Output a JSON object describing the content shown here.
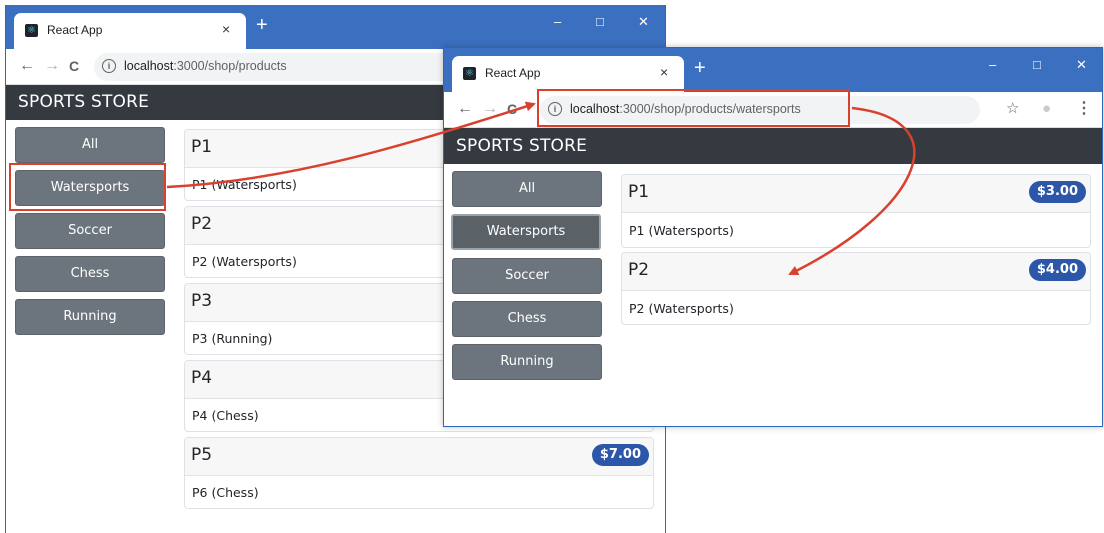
{
  "tab_title": "React App",
  "tab_close": "×",
  "new_tab": "+",
  "win_controls": {
    "minimize": "–",
    "maximize": "□",
    "close": "✕"
  },
  "nav": {
    "back": "←",
    "forward": "→",
    "reload": "C",
    "info": "i",
    "star": "☆",
    "profile": "●",
    "menu": "⋮"
  },
  "url1": {
    "host": "localhost",
    "path": ":3000/shop/products"
  },
  "url2": {
    "host": "localhost",
    "path": ":3000/shop/products/watersports"
  },
  "brand": "SPORTS STORE",
  "categories": [
    "All",
    "Watersports",
    "Soccer",
    "Chess",
    "Running"
  ],
  "window1": {
    "products": [
      {
        "name": "P1",
        "desc": "P1 (Watersports)"
      },
      {
        "name": "P2",
        "desc": "P2 (Watersports)"
      },
      {
        "name": "P3",
        "desc": "P3 (Running)"
      },
      {
        "name": "P4",
        "desc": "P4 (Chess)"
      },
      {
        "name": "P5",
        "desc": "P6 (Chess)",
        "price": "$7.00"
      }
    ]
  },
  "window2": {
    "products": [
      {
        "name": "P1",
        "desc": "P1 (Watersports)",
        "price": "$3.00"
      },
      {
        "name": "P2",
        "desc": "P2 (Watersports)",
        "price": "$4.00"
      }
    ]
  },
  "colors": {
    "titlebar": "#3b70c0",
    "navbar": "#343a40",
    "button": "#6c757d",
    "badge": "#2c57a8",
    "highlight": "#d9412e"
  }
}
